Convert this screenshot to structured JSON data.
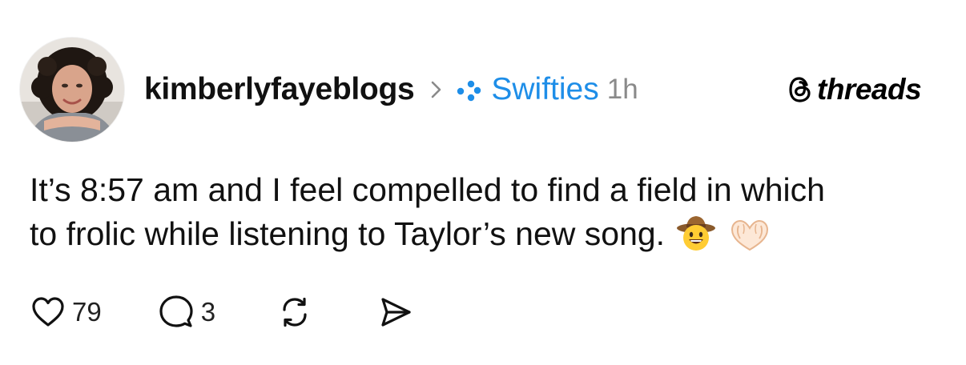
{
  "post": {
    "username": "kimberlyfayeblogs",
    "community": "Swifties",
    "time": "1h",
    "body_line1": "It’s 8:57 am and I feel compelled to find a field in which",
    "body_line2": "to frolic while listening to Taylor’s new song.",
    "emojis": [
      "cowboy-face-emoji",
      "heart-hands-emoji"
    ]
  },
  "brand": {
    "word": "threads"
  },
  "actions": {
    "likes": "79",
    "replies": "3"
  },
  "icons": {
    "avatar": "avatar",
    "separator": "chevron-right-icon",
    "community": "community-dots-icon",
    "brand": "threads-logo-icon",
    "like": "heart-icon",
    "reply": "comment-icon",
    "repost": "repost-icon",
    "share": "send-icon"
  },
  "colors": {
    "community": "#1e8ee8",
    "time": "#8a8a8a",
    "text": "#111111"
  }
}
